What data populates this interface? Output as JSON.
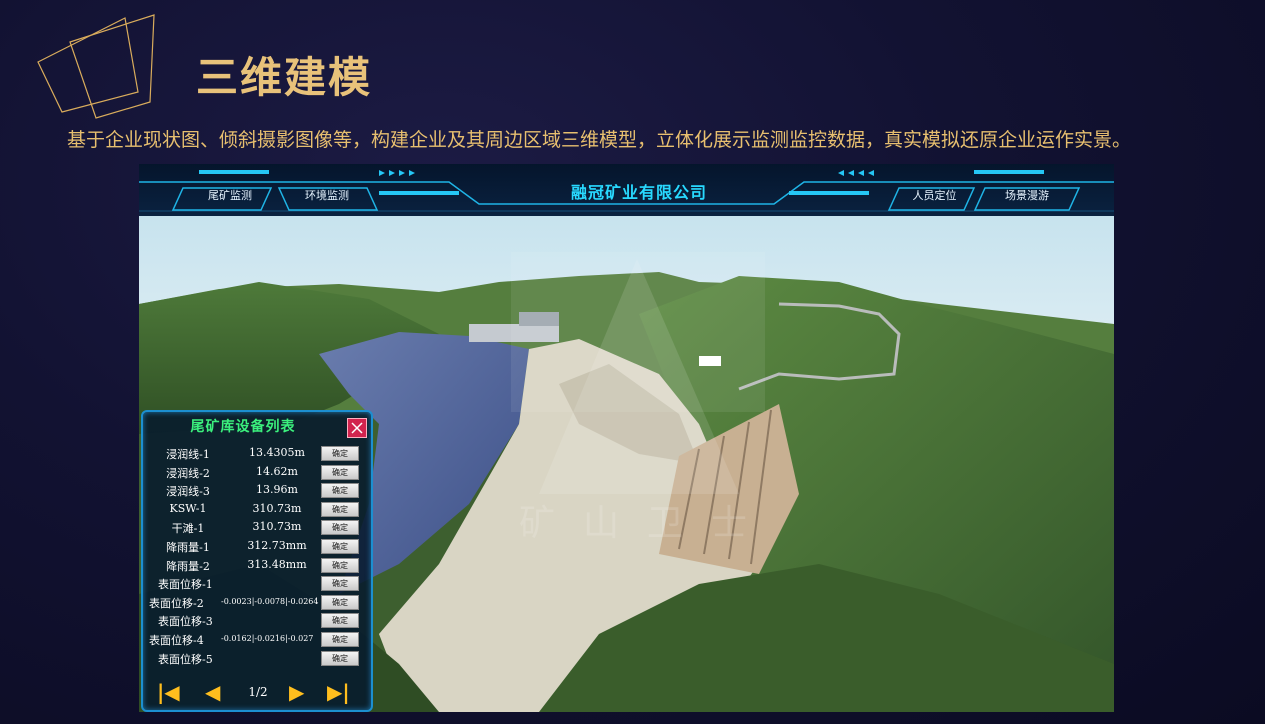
{
  "page": {
    "title": "三维建模",
    "description": "基于企业现状图、倾斜摄影图像等，构建企业及其周边区域三维模型，立体化展示监测监控数据，真实模拟还原企业运作实景。"
  },
  "hud": {
    "company": "融冠矿业有限公司",
    "tabs_left": [
      "尾矿监测",
      "环境监测"
    ],
    "tabs_right": [
      "人员定位",
      "场景漫游"
    ]
  },
  "panel": {
    "title": "尾矿库设备列表",
    "confirm_label": "确定",
    "rows": [
      {
        "label": "浸润线-1",
        "value": "13.4305m"
      },
      {
        "label": "浸润线-2",
        "value": "14.62m"
      },
      {
        "label": "浸润线-3",
        "value": "13.96m"
      },
      {
        "label": "KSW-1",
        "value": "310.73m"
      },
      {
        "label": "干滩-1",
        "value": "310.73m"
      },
      {
        "label": "降雨量-1",
        "value": "312.73mm"
      },
      {
        "label": "降雨量-2",
        "value": "313.48mm"
      },
      {
        "label": "表面位移-1",
        "value": ""
      },
      {
        "label": "表面位移-2",
        "value": "-0.0023|-0.0078|-0.0264"
      },
      {
        "label": "表面位移-3",
        "value": ""
      },
      {
        "label": "表面位移-4",
        "value": "-0.0162|-0.0216|-0.027"
      },
      {
        "label": "表面位移-5",
        "value": ""
      }
    ],
    "pager": {
      "page": "1/2",
      "first": "|◀",
      "prev": "◀",
      "next": "▶",
      "last": "▶|"
    }
  },
  "watermark": "矿山卫士",
  "colors": {
    "accent_gold": "#e8c27a",
    "hud_cyan": "#28d9ff",
    "panel_green": "#3bf07d",
    "pager_orange": "#ffbe1e"
  }
}
